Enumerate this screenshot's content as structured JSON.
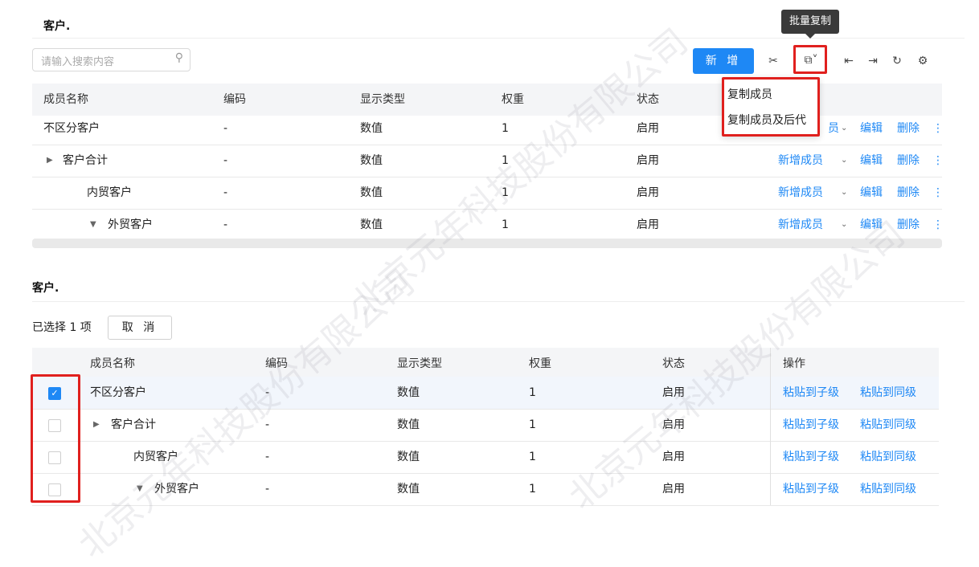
{
  "panel1": {
    "title": "客户.",
    "search_placeholder": "请输入搜索内容",
    "add_button": "新 增",
    "tooltip": "批量复制",
    "dropdown": [
      "复制成员",
      "复制成员及后代"
    ],
    "columns": [
      "成员名称",
      "编码",
      "显示类型",
      "权重",
      "状态"
    ],
    "rows": [
      {
        "name": "不区分客户",
        "code": "-",
        "type": "数值",
        "weight": "1",
        "status": "启用",
        "actions": [
          "新增成员",
          "编辑",
          "删除"
        ]
      },
      {
        "name": "客户合计",
        "code": "-",
        "type": "数值",
        "weight": "1",
        "status": "启用",
        "actions": [
          "新增成员",
          "编辑",
          "删除"
        ]
      },
      {
        "name": "内贸客户",
        "code": "-",
        "type": "数值",
        "weight": "1",
        "status": "启用",
        "actions": [
          "新增成员",
          "编辑",
          "删除"
        ]
      },
      {
        "name": "外贸客户",
        "code": "-",
        "type": "数值",
        "weight": "1",
        "status": "启用",
        "actions": [
          "新增成员",
          "编辑",
          "删除"
        ]
      }
    ],
    "partial_action": "员"
  },
  "panel2": {
    "title": "客户.",
    "selected_text": "已选择 1 项",
    "cancel_button": "取 消",
    "columns": [
      "成员名称",
      "编码",
      "显示类型",
      "权重",
      "状态",
      "操作"
    ],
    "rows": [
      {
        "name": "不区分客户",
        "code": "-",
        "type": "数值",
        "weight": "1",
        "status": "启用",
        "checked": true,
        "paste_child": "粘贴到子级",
        "paste_sibling": "粘贴到同级"
      },
      {
        "name": "客户合计",
        "code": "-",
        "type": "数值",
        "weight": "1",
        "status": "启用",
        "checked": false,
        "paste_child": "粘贴到子级",
        "paste_sibling": "粘贴到同级"
      },
      {
        "name": "内贸客户",
        "code": "-",
        "type": "数值",
        "weight": "1",
        "status": "启用",
        "checked": false,
        "paste_child": "粘贴到子级",
        "paste_sibling": "粘贴到同级"
      },
      {
        "name": "外贸客户",
        "code": "-",
        "type": "数值",
        "weight": "1",
        "status": "启用",
        "checked": false,
        "paste_child": "粘贴到子级",
        "paste_sibling": "粘贴到同级"
      }
    ]
  },
  "watermark": "北京元年科技股份有限公司",
  "colors": {
    "primary": "#1e88f5",
    "highlight": "#e0201e",
    "tooltip_bg": "#3a3a3a"
  }
}
